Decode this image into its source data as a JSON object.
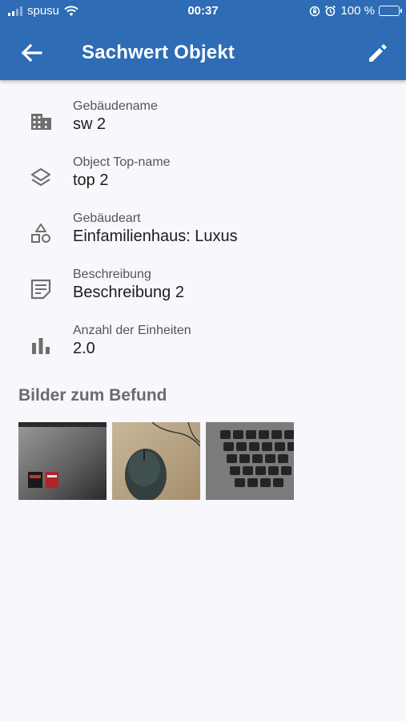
{
  "status_bar": {
    "carrier": "spusu",
    "time": "00:37",
    "battery": "100 %"
  },
  "app_bar": {
    "title": "Sachwert Objekt"
  },
  "fields": [
    {
      "label": "Gebäudename",
      "value": "sw 2"
    },
    {
      "label": "Object Top-name",
      "value": "top 2"
    },
    {
      "label": "Gebäudeart",
      "value": "Einfamilienhaus: Luxus"
    },
    {
      "label": "Beschreibung",
      "value": "Beschreibung 2"
    },
    {
      "label": "Anzahl der Einheiten",
      "value": "2.0"
    }
  ],
  "images_section": {
    "heading": "Bilder zum Befund"
  },
  "colors": {
    "app_bar": "#2e6cb5",
    "background": "#f8f7fb",
    "icon": "#6e6e6e"
  }
}
